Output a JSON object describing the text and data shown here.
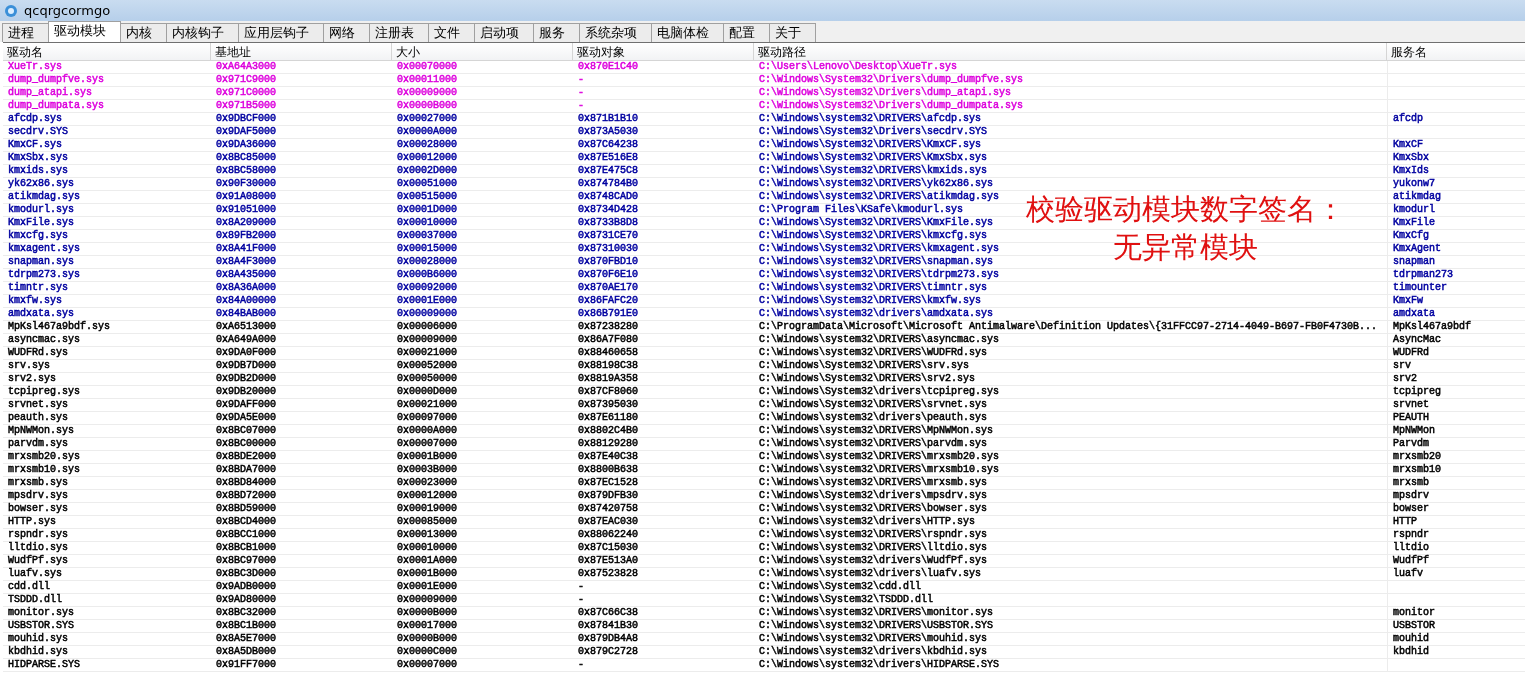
{
  "window": {
    "title": "qcqrgcormgo"
  },
  "tabs": [
    {
      "label": "进程",
      "selected": false
    },
    {
      "label": "驱动模块",
      "selected": true
    },
    {
      "label": "内核",
      "selected": false
    },
    {
      "label": "内核钩子",
      "selected": false
    },
    {
      "label": "应用层钩子",
      "selected": false
    },
    {
      "label": "网络",
      "selected": false
    },
    {
      "label": "注册表",
      "selected": false
    },
    {
      "label": "文件",
      "selected": false
    },
    {
      "label": "启动项",
      "selected": false
    },
    {
      "label": "服务",
      "selected": false
    },
    {
      "label": "系统杂项",
      "selected": false
    },
    {
      "label": "电脑体检",
      "selected": false
    },
    {
      "label": "配置",
      "selected": false
    },
    {
      "label": "关于",
      "selected": false
    }
  ],
  "table": {
    "columns": [
      "驱动名",
      "基地址",
      "大小",
      "驱动对象",
      "驱动路径",
      "服务名"
    ],
    "rows": [
      {
        "name": "XueTr.sys",
        "base": "0xA64A3000",
        "size": "0x00070000",
        "object": "0x870E1C40",
        "path": "C:\\Users\\Lenovo\\Desktop\\XueTr.sys",
        "color": "#dd00dd"
      },
      {
        "name": "dump_dumpfve.sys",
        "base": "0x971C9000",
        "size": "0x00011000",
        "object": "-",
        "path": "C:\\Windows\\System32\\Drivers\\dump_dumpfve.sys",
        "color": "#dd00dd"
      },
      {
        "name": "dump_atapi.sys",
        "base": "0x971C0000",
        "size": "0x00009000",
        "object": "-",
        "path": "C:\\Windows\\System32\\Drivers\\dump_atapi.sys",
        "color": "#dd00dd"
      },
      {
        "name": "dump_dumpata.sys",
        "base": "0x971B5000",
        "size": "0x0000B000",
        "object": "-",
        "path": "C:\\Windows\\System32\\Drivers\\dump_dumpata.sys",
        "color": "#dd00dd"
      },
      {
        "name": "afcdp.sys",
        "base": "0x9DBCF000",
        "size": "0x00027000",
        "object": "0x871B1B10",
        "path": "C:\\Windows\\system32\\DRIVERS\\afcdp.sys",
        "service": "afcdp",
        "color": "#0000a0"
      },
      {
        "name": "secdrv.SYS",
        "base": "0x9DAF5000",
        "size": "0x0000A000",
        "object": "0x873A5030",
        "path": "C:\\Windows\\System32\\Drivers\\secdrv.SYS",
        "color": "#0000a0"
      },
      {
        "name": "KmxCF.sys",
        "base": "0x9DA36000",
        "size": "0x00028000",
        "object": "0x87C64238",
        "path": "C:\\Windows\\System32\\DRIVERS\\KmxCF.sys",
        "service": "KmxCF",
        "color": "#0000a0"
      },
      {
        "name": "KmxSbx.sys",
        "base": "0x8BC85000",
        "size": "0x00012000",
        "object": "0x87E516E8",
        "path": "C:\\Windows\\System32\\DRIVERS\\KmxSbx.sys",
        "service": "KmxSbx",
        "color": "#0000a0"
      },
      {
        "name": "kmxids.sys",
        "base": "0x8BC58000",
        "size": "0x0002D000",
        "object": "0x87E475C8",
        "path": "C:\\Windows\\System32\\DRIVERS\\kmxids.sys",
        "service": "KmxIds",
        "color": "#0000a0"
      },
      {
        "name": "yk62x86.sys",
        "base": "0x90F30000",
        "size": "0x00051000",
        "object": "0x874784B0",
        "path": "C:\\Windows\\system32\\DRIVERS\\yk62x86.sys",
        "service": "yukonw7",
        "color": "#0000a0"
      },
      {
        "name": "atikmdag.sys",
        "base": "0x91A08000",
        "size": "0x00515000",
        "object": "0x8748CAD0",
        "path": "C:\\Windows\\system32\\DRIVERS\\atikmdag.sys",
        "service": "atikmdag",
        "color": "#0000a0"
      },
      {
        "name": "kmodurl.sys",
        "base": "0x91051000",
        "size": "0x0001D000",
        "object": "0x8734D428",
        "path": "C:\\Program Files\\KSafe\\kmodurl.sys",
        "service": "kmodurl",
        "color": "#0000a0"
      },
      {
        "name": "KmxFile.sys",
        "base": "0x8A209000",
        "size": "0x00010000",
        "object": "0x8733B8D8",
        "path": "C:\\Windows\\System32\\DRIVERS\\KmxFile.sys",
        "service": "KmxFile",
        "color": "#0000a0"
      },
      {
        "name": "kmxcfg.sys",
        "base": "0x89FB2000",
        "size": "0x00037000",
        "object": "0x8731CE70",
        "path": "C:\\Windows\\System32\\DRIVERS\\kmxcfg.sys",
        "service": "KmxCfg",
        "color": "#0000a0"
      },
      {
        "name": "kmxagent.sys",
        "base": "0x8A41F000",
        "size": "0x00015000",
        "object": "0x87310030",
        "path": "C:\\Windows\\System32\\DRIVERS\\kmxagent.sys",
        "service": "KmxAgent",
        "color": "#0000a0"
      },
      {
        "name": "snapman.sys",
        "base": "0x8A4F3000",
        "size": "0x00028000",
        "object": "0x870FBD10",
        "path": "C:\\Windows\\system32\\DRIVERS\\snapman.sys",
        "service": "snapman",
        "color": "#0000a0"
      },
      {
        "name": "tdrpm273.sys",
        "base": "0x8A435000",
        "size": "0x000B6000",
        "object": "0x870F6E10",
        "path": "C:\\Windows\\system32\\DRIVERS\\tdrpm273.sys",
        "service": "tdrpman273",
        "color": "#0000a0"
      },
      {
        "name": "timntr.sys",
        "base": "0x8A36A000",
        "size": "0x00092000",
        "object": "0x870AE170",
        "path": "C:\\Windows\\system32\\DRIVERS\\timntr.sys",
        "service": "timounter",
        "color": "#0000a0"
      },
      {
        "name": "kmxfw.sys",
        "base": "0x84A00000",
        "size": "0x0001E000",
        "object": "0x86FAFC20",
        "path": "C:\\Windows\\System32\\DRIVERS\\kmxfw.sys",
        "service": "KmxFw",
        "color": "#0000a0"
      },
      {
        "name": "amdxata.sys",
        "base": "0x84BAB000",
        "size": "0x00009000",
        "object": "0x86B791E0",
        "path": "C:\\Windows\\system32\\drivers\\amdxata.sys",
        "service": "amdxata",
        "color": "#0000a0"
      },
      {
        "name": "MpKsl467a9bdf.sys",
        "base": "0xA6513000",
        "size": "0x00006000",
        "object": "0x87238280",
        "path": "C:\\ProgramData\\Microsoft\\Microsoft Antimalware\\Definition Updates\\{31FFCC97-2714-4049-B697-FB0F4730B...",
        "service": "MpKsl467a9bdf",
        "color": "#000000"
      },
      {
        "name": "asyncmac.sys",
        "base": "0xA649A000",
        "size": "0x00009000",
        "object": "0x86A7F080",
        "path": "C:\\Windows\\system32\\DRIVERS\\asyncmac.sys",
        "service": "AsyncMac",
        "color": "#000000"
      },
      {
        "name": "WUDFRd.sys",
        "base": "0x9DA0F000",
        "size": "0x00021000",
        "object": "0x88460658",
        "path": "C:\\Windows\\system32\\DRIVERS\\WUDFRd.sys",
        "service": "WUDFRd",
        "color": "#000000"
      },
      {
        "name": "srv.sys",
        "base": "0x9DB7D000",
        "size": "0x00052000",
        "object": "0x88198C38",
        "path": "C:\\Windows\\System32\\DRIVERS\\srv.sys",
        "service": "srv",
        "color": "#000000"
      },
      {
        "name": "srv2.sys",
        "base": "0x9DB2D000",
        "size": "0x00050000",
        "object": "0x8819A358",
        "path": "C:\\Windows\\System32\\DRIVERS\\srv2.sys",
        "service": "srv2",
        "color": "#000000"
      },
      {
        "name": "tcpipreg.sys",
        "base": "0x9DB20000",
        "size": "0x0000D000",
        "object": "0x87CF8060",
        "path": "C:\\Windows\\System32\\drivers\\tcpipreg.sys",
        "service": "tcpipreg",
        "color": "#000000"
      },
      {
        "name": "srvnet.sys",
        "base": "0x9DAFF000",
        "size": "0x00021000",
        "object": "0x87395030",
        "path": "C:\\Windows\\System32\\DRIVERS\\srvnet.sys",
        "service": "srvnet",
        "color": "#000000"
      },
      {
        "name": "peauth.sys",
        "base": "0x9DA5E000",
        "size": "0x00097000",
        "object": "0x87E61180",
        "path": "C:\\Windows\\system32\\drivers\\peauth.sys",
        "service": "PEAUTH",
        "color": "#000000"
      },
      {
        "name": "MpNWMon.sys",
        "base": "0x8BC07000",
        "size": "0x0000A000",
        "object": "0x8802C4B0",
        "path": "C:\\Windows\\system32\\DRIVERS\\MpNWMon.sys",
        "service": "MpNWMon",
        "color": "#000000"
      },
      {
        "name": "parvdm.sys",
        "base": "0x8BC00000",
        "size": "0x00007000",
        "object": "0x88129280",
        "path": "C:\\Windows\\system32\\DRIVERS\\parvdm.sys",
        "service": "Parvdm",
        "color": "#000000"
      },
      {
        "name": "mrxsmb20.sys",
        "base": "0x8BDE2000",
        "size": "0x0001B000",
        "object": "0x87E40C38",
        "path": "C:\\Windows\\system32\\DRIVERS\\mrxsmb20.sys",
        "service": "mrxsmb20",
        "color": "#000000"
      },
      {
        "name": "mrxsmb10.sys",
        "base": "0x8BDA7000",
        "size": "0x0003B000",
        "object": "0x8800B638",
        "path": "C:\\Windows\\system32\\DRIVERS\\mrxsmb10.sys",
        "service": "mrxsmb10",
        "color": "#000000"
      },
      {
        "name": "mrxsmb.sys",
        "base": "0x8BD84000",
        "size": "0x00023000",
        "object": "0x87EC1528",
        "path": "C:\\Windows\\system32\\DRIVERS\\mrxsmb.sys",
        "service": "mrxsmb",
        "color": "#000000"
      },
      {
        "name": "mpsdrv.sys",
        "base": "0x8BD72000",
        "size": "0x00012000",
        "object": "0x879DFB30",
        "path": "C:\\Windows\\System32\\drivers\\mpsdrv.sys",
        "service": "mpsdrv",
        "color": "#000000"
      },
      {
        "name": "bowser.sys",
        "base": "0x8BD59000",
        "size": "0x00019000",
        "object": "0x87420758",
        "path": "C:\\Windows\\system32\\DRIVERS\\bowser.sys",
        "service": "bowser",
        "color": "#000000"
      },
      {
        "name": "HTTP.sys",
        "base": "0x8BCD4000",
        "size": "0x00085000",
        "object": "0x87EAC030",
        "path": "C:\\Windows\\system32\\drivers\\HTTP.sys",
        "service": "HTTP",
        "color": "#000000"
      },
      {
        "name": "rspndr.sys",
        "base": "0x8BCC1000",
        "size": "0x00013000",
        "object": "0x88062240",
        "path": "C:\\Windows\\system32\\DRIVERS\\rspndr.sys",
        "service": "rspndr",
        "color": "#000000"
      },
      {
        "name": "lltdio.sys",
        "base": "0x8BCB1000",
        "size": "0x00010000",
        "object": "0x87C15030",
        "path": "C:\\Windows\\system32\\DRIVERS\\lltdio.sys",
        "service": "lltdio",
        "color": "#000000"
      },
      {
        "name": "WudfPf.sys",
        "base": "0x8BC97000",
        "size": "0x0001A000",
        "object": "0x87E513A0",
        "path": "C:\\Windows\\system32\\drivers\\WudfPf.sys",
        "service": "WudfPf",
        "color": "#000000"
      },
      {
        "name": "luafv.sys",
        "base": "0x8BC3D000",
        "size": "0x0001B000",
        "object": "0x87523828",
        "path": "C:\\Windows\\system32\\drivers\\luafv.sys",
        "service": "luafv",
        "color": "#000000"
      },
      {
        "name": "cdd.dll",
        "base": "0x9ADB0000",
        "size": "0x0001E000",
        "object": "-",
        "path": "C:\\Windows\\System32\\cdd.dll",
        "color": "#000000"
      },
      {
        "name": "TSDDD.dll",
        "base": "0x9AD80000",
        "size": "0x00009000",
        "object": "-",
        "path": "C:\\Windows\\System32\\TSDDD.dll",
        "color": "#000000"
      },
      {
        "name": "monitor.sys",
        "base": "0x8BC32000",
        "size": "0x0000B000",
        "object": "0x87C66C38",
        "path": "C:\\Windows\\system32\\DRIVERS\\monitor.sys",
        "service": "monitor",
        "color": "#000000"
      },
      {
        "name": "USBSTOR.SYS",
        "base": "0x8BC1B000",
        "size": "0x00017000",
        "object": "0x87841B30",
        "path": "C:\\Windows\\system32\\DRIVERS\\USBSTOR.SYS",
        "service": "USBSTOR",
        "color": "#000000"
      },
      {
        "name": "mouhid.sys",
        "base": "0x8A5E7000",
        "size": "0x0000B000",
        "object": "0x879DB4A8",
        "path": "C:\\Windows\\system32\\DRIVERS\\mouhid.sys",
        "service": "mouhid",
        "color": "#000000"
      },
      {
        "name": "kbdhid.sys",
        "base": "0x8A5DB000",
        "size": "0x0000C000",
        "object": "0x879C2728",
        "path": "C:\\Windows\\system32\\drivers\\kbdhid.sys",
        "service": "kbdhid",
        "color": "#000000"
      },
      {
        "name": "HIDPARSE.SYS",
        "base": "0x91FF7000",
        "size": "0x00007000",
        "object": "-",
        "path": "C:\\Windows\\system32\\drivers\\HIDPARSE.SYS",
        "color": "#000000"
      }
    ]
  },
  "annotation": {
    "lines": [
      "校验驱动模块数字签名：",
      "无异常模块"
    ]
  }
}
